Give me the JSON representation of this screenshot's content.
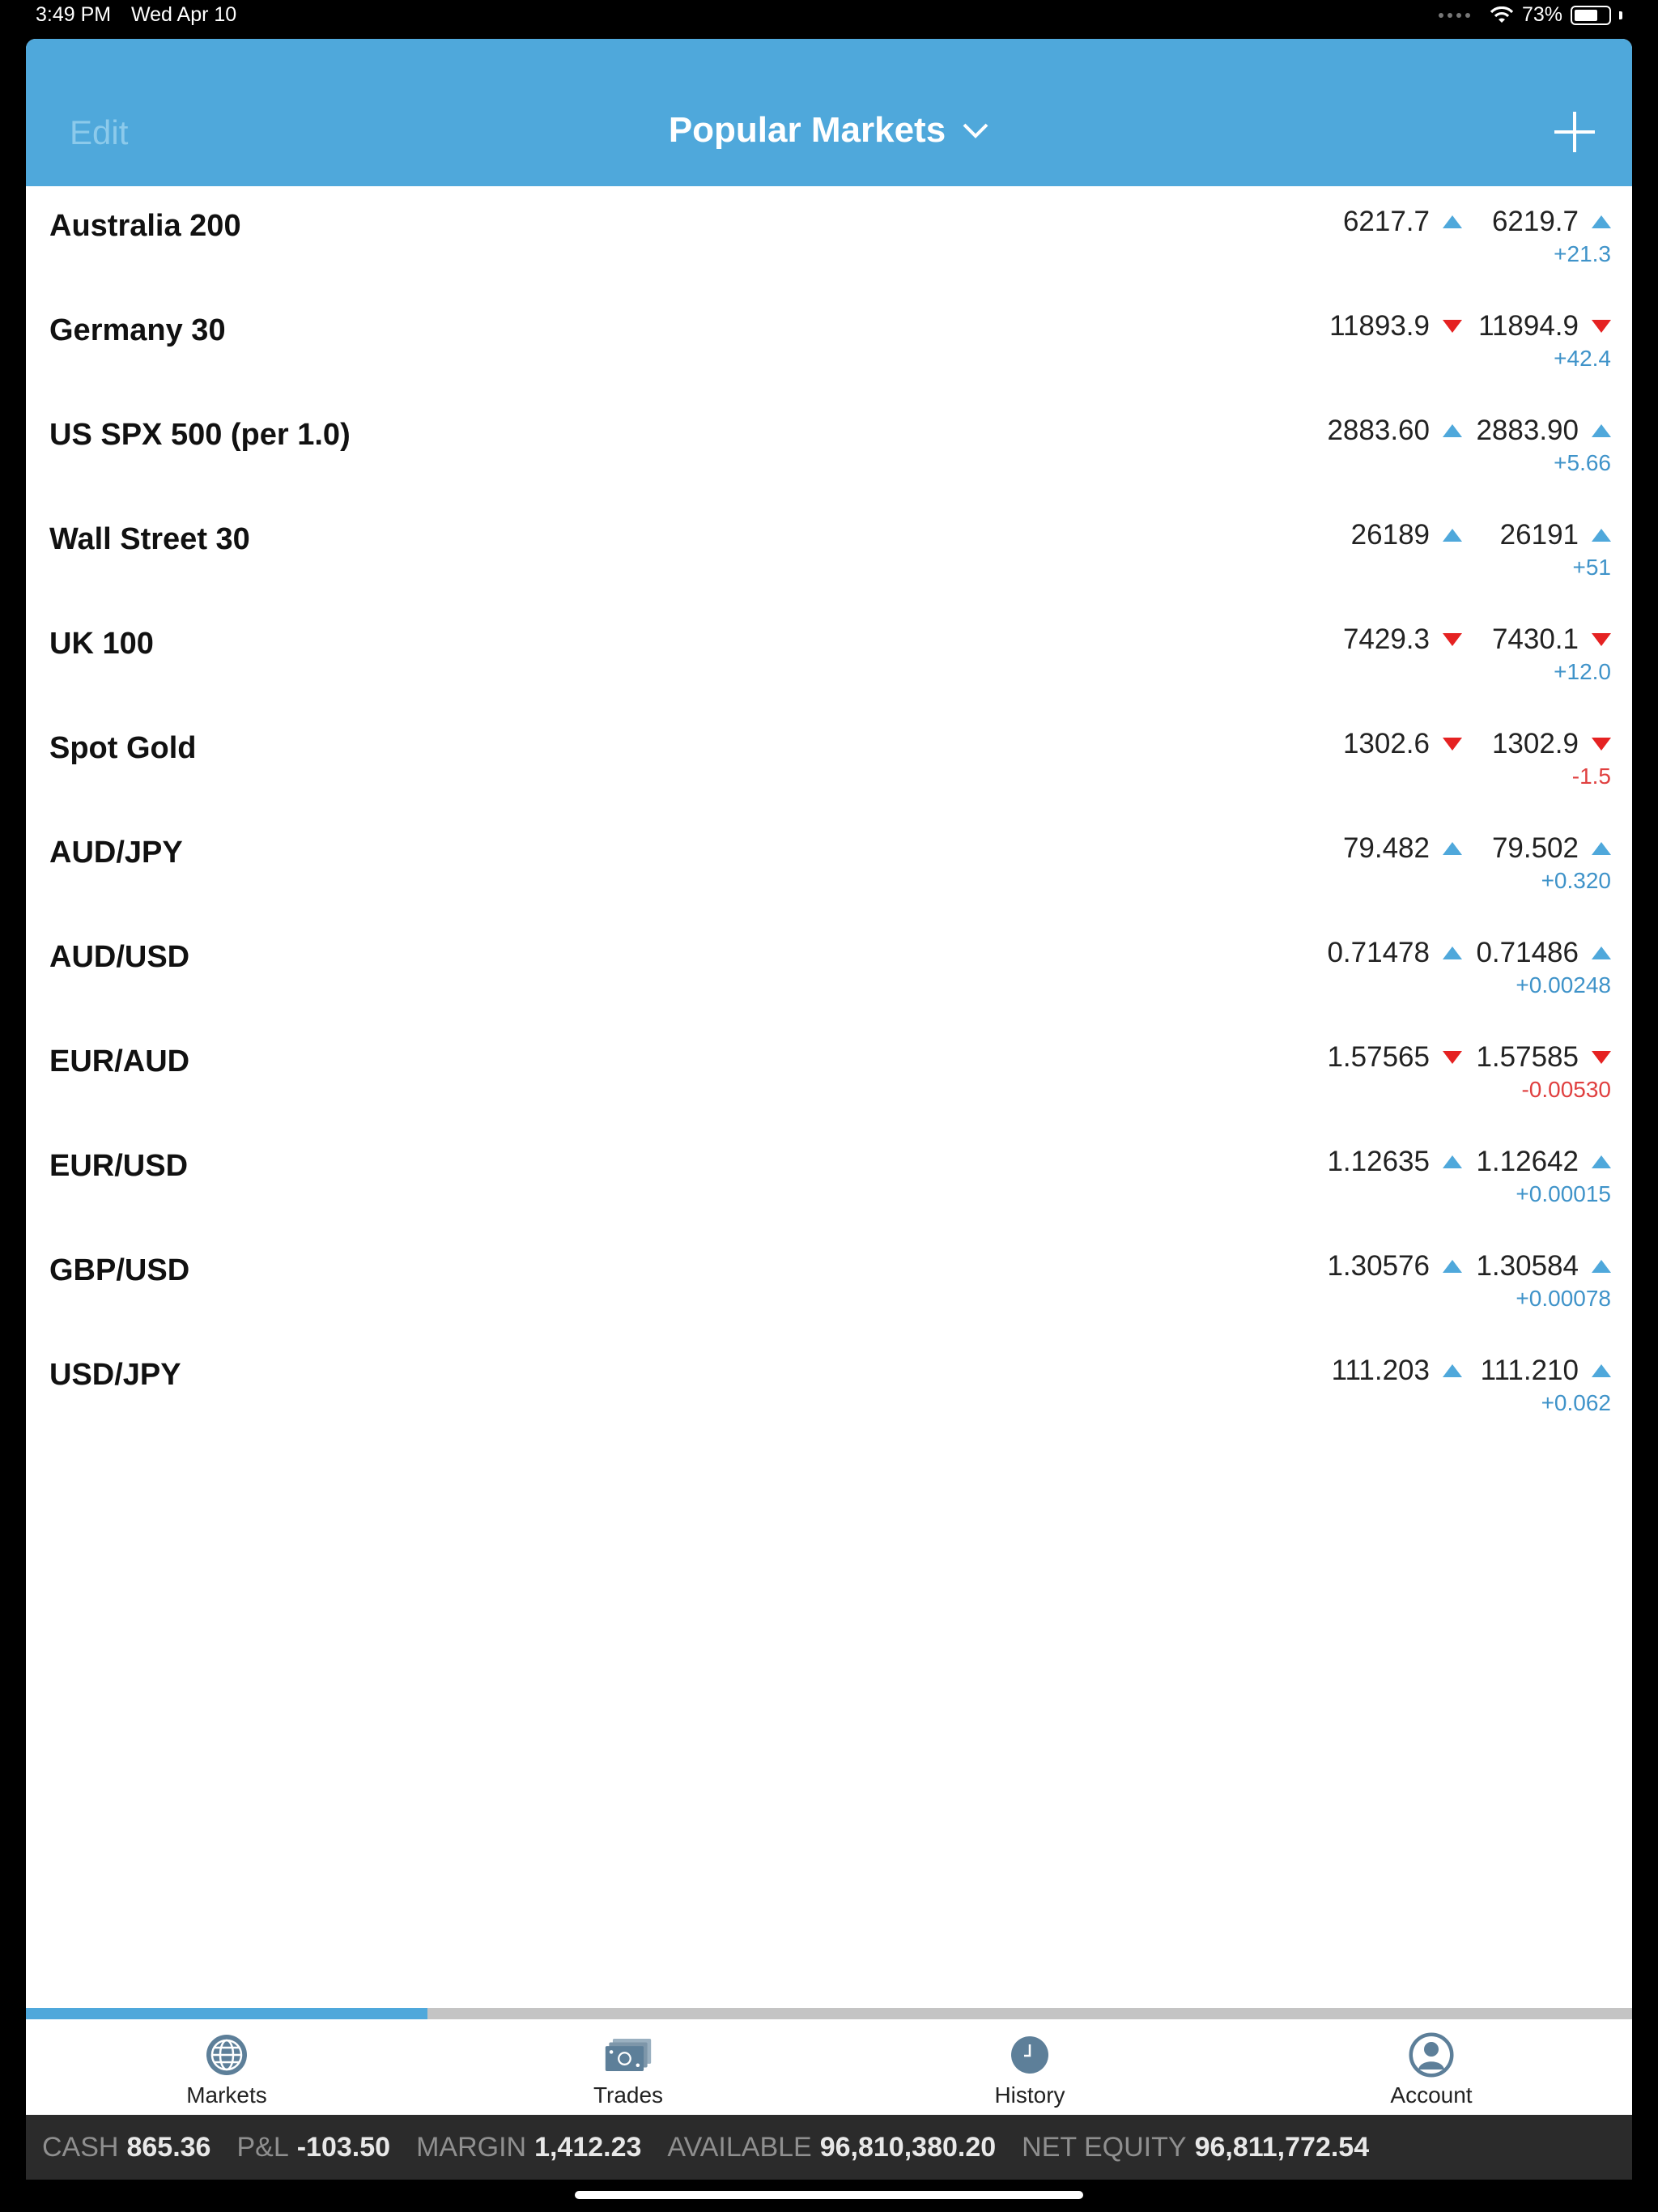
{
  "status_bar": {
    "time": "3:49 PM",
    "date": "Wed Apr 10",
    "battery": "73%",
    "battery_level": 0.73
  },
  "header": {
    "edit_label": "Edit",
    "title": "Popular Markets"
  },
  "markets": [
    {
      "name": "Australia 200",
      "bid": "6217.7",
      "bid_dir": "up",
      "ask": "6219.7",
      "ask_dir": "up",
      "change": "+21.3",
      "change_sign": "pos"
    },
    {
      "name": "Germany 30",
      "bid": "11893.9",
      "bid_dir": "down",
      "ask": "11894.9",
      "ask_dir": "down",
      "change": "+42.4",
      "change_sign": "pos"
    },
    {
      "name": "US SPX 500 (per 1.0)",
      "bid": "2883.60",
      "bid_dir": "up",
      "ask": "2883.90",
      "ask_dir": "up",
      "change": "+5.66",
      "change_sign": "pos"
    },
    {
      "name": "Wall Street 30",
      "bid": "26189",
      "bid_dir": "up",
      "ask": "26191",
      "ask_dir": "up",
      "change": "+51",
      "change_sign": "pos"
    },
    {
      "name": "UK 100",
      "bid": "7429.3",
      "bid_dir": "down",
      "ask": "7430.1",
      "ask_dir": "down",
      "change": "+12.0",
      "change_sign": "pos"
    },
    {
      "name": "Spot Gold",
      "bid": "1302.6",
      "bid_dir": "down",
      "ask": "1302.9",
      "ask_dir": "down",
      "change": "-1.5",
      "change_sign": "neg"
    },
    {
      "name": "AUD/JPY",
      "bid": "79.482",
      "bid_dir": "up",
      "ask": "79.502",
      "ask_dir": "up",
      "change": "+0.320",
      "change_sign": "pos"
    },
    {
      "name": "AUD/USD",
      "bid": "0.71478",
      "bid_dir": "up",
      "ask": "0.71486",
      "ask_dir": "up",
      "change": "+0.00248",
      "change_sign": "pos"
    },
    {
      "name": "EUR/AUD",
      "bid": "1.57565",
      "bid_dir": "down",
      "ask": "1.57585",
      "ask_dir": "down",
      "change": "-0.00530",
      "change_sign": "neg"
    },
    {
      "name": "EUR/USD",
      "bid": "1.12635",
      "bid_dir": "up",
      "ask": "1.12642",
      "ask_dir": "up",
      "change": "+0.00015",
      "change_sign": "pos"
    },
    {
      "name": "GBP/USD",
      "bid": "1.30576",
      "bid_dir": "up",
      "ask": "1.30584",
      "ask_dir": "up",
      "change": "+0.00078",
      "change_sign": "pos"
    },
    {
      "name": "USD/JPY",
      "bid": "111.203",
      "bid_dir": "up",
      "ask": "111.210",
      "ask_dir": "up",
      "change": "+0.062",
      "change_sign": "pos"
    }
  ],
  "active_tab_progress": 0.25,
  "tabs": [
    {
      "label": "Markets",
      "icon": "globe-icon"
    },
    {
      "label": "Trades",
      "icon": "cash-icon"
    },
    {
      "label": "History",
      "icon": "clock-icon"
    },
    {
      "label": "Account",
      "icon": "user-icon"
    }
  ],
  "summary": {
    "cash_label": "CASH",
    "cash_value": "865.36",
    "pl_label": "P&L",
    "pl_value": "-103.50",
    "margin_label": "MARGIN",
    "margin_value": "1,412.23",
    "available_label": "AVAILABLE",
    "available_value": "96,810,380.20",
    "equity_label": "NET EQUITY",
    "equity_value": "96,811,772.54"
  },
  "colors": {
    "header": "#4fa8db",
    "up": "#4fa8db",
    "down": "#e52222",
    "positive_change": "#3f93c9",
    "negative_change": "#e04040",
    "summary_bg": "#2b2b2b"
  }
}
